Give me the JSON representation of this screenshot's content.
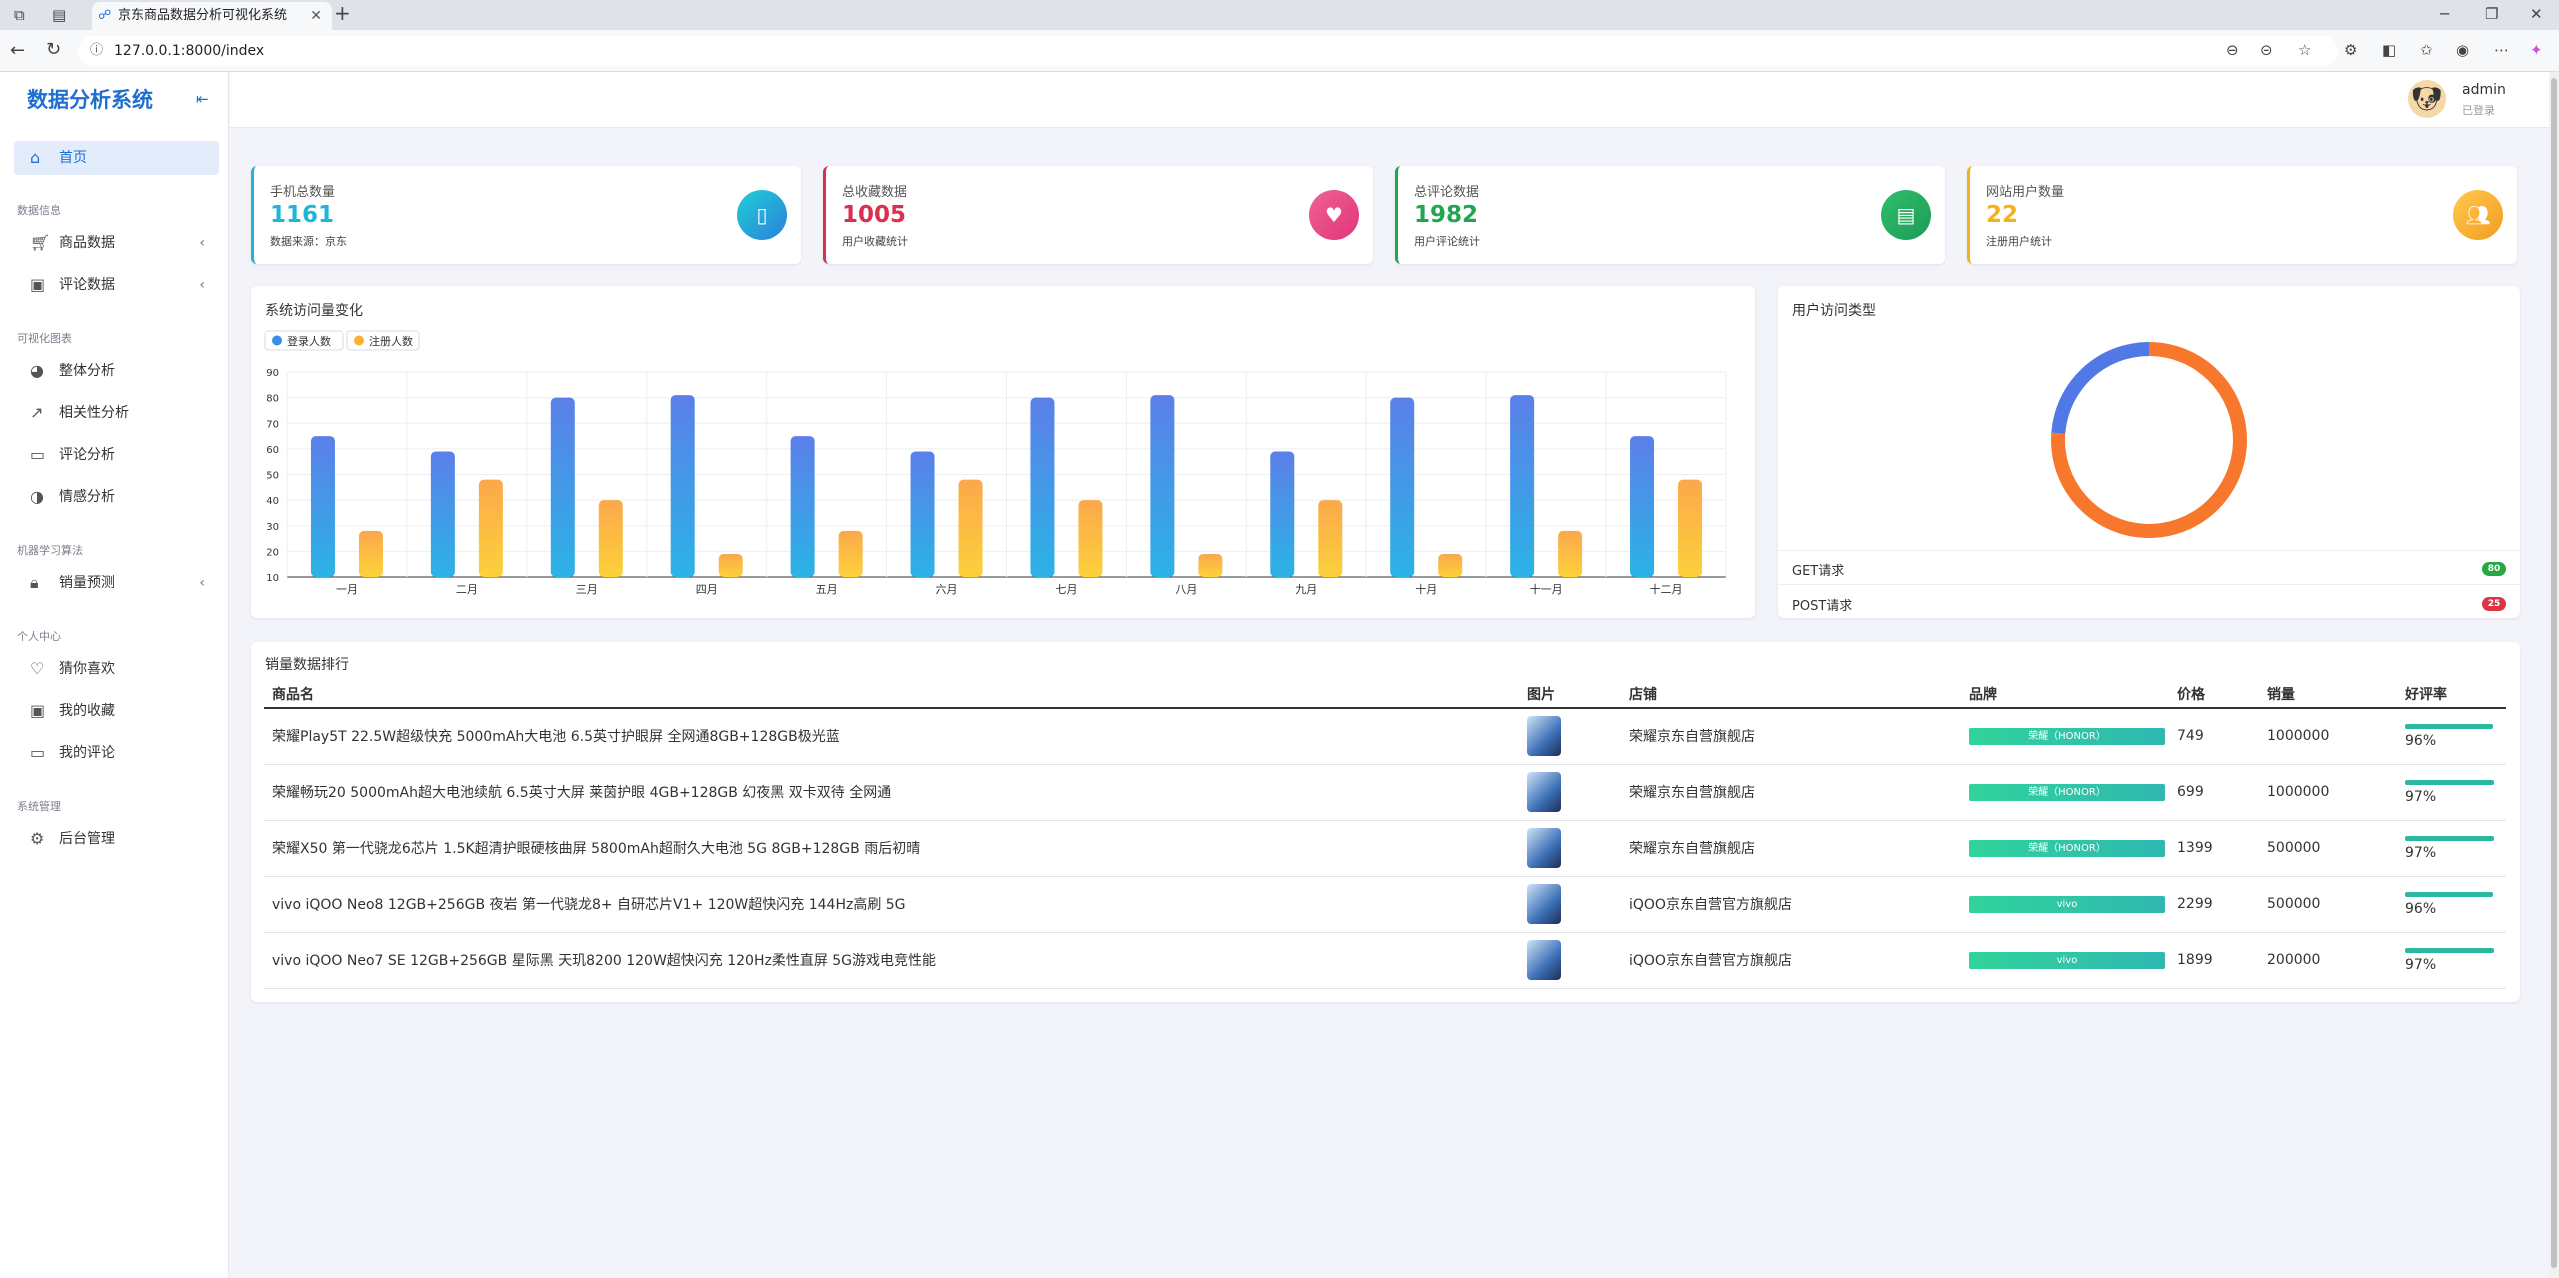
{
  "browser": {
    "tab_title": "京东商品数据分析可视化系统",
    "url": "127.0.0.1:8000/index"
  },
  "sidebar": {
    "brand": "数据分析系统",
    "home": "首页",
    "sections": [
      {
        "title": "数据信息",
        "items": [
          "商品数据",
          "评论数据"
        ]
      },
      {
        "title": "可视化图表",
        "items": [
          "整体分析",
          "相关性分析",
          "评论分析",
          "情感分析"
        ]
      },
      {
        "title": "机器学习算法",
        "items": [
          "销量预测"
        ]
      },
      {
        "title": "个人中心",
        "items": [
          "猜你喜欢",
          "我的收藏",
          "我的评论"
        ]
      },
      {
        "title": "系统管理",
        "items": [
          "后台管理"
        ]
      }
    ]
  },
  "user": {
    "name": "admin",
    "status": "已登录"
  },
  "stats": [
    {
      "label": "手机总数量",
      "value": "1161",
      "sub": "数据来源：京东",
      "color": "#1fb5d8"
    },
    {
      "label": "总收藏数据",
      "value": "1005",
      "sub": "用户收藏统计",
      "color": "#d9304f"
    },
    {
      "label": "总评论数据",
      "value": "1982",
      "sub": "用户评论统计",
      "color": "#1fa64f"
    },
    {
      "label": "网站用户数量",
      "value": "22",
      "sub": "注册用户统计",
      "color": "#f2b21c"
    }
  ],
  "bar_chart_title": "系统访问量变化",
  "pie_chart_title": "用户访问类型",
  "chart_data": [
    {
      "type": "bar",
      "title": "系统访问量变化",
      "categories": [
        "一月",
        "二月",
        "三月",
        "四月",
        "五月",
        "六月",
        "七月",
        "八月",
        "九月",
        "十月",
        "十一月",
        "十二月"
      ],
      "series": [
        {
          "name": "登录人数",
          "values": [
            65,
            59,
            80,
            81,
            65,
            59,
            80,
            81,
            59,
            80,
            81,
            65
          ],
          "color": "#3a8ee6"
        },
        {
          "name": "注册人数",
          "values": [
            28,
            48,
            40,
            19,
            28,
            48,
            40,
            19,
            40,
            19,
            28,
            48
          ],
          "color": "#fbb034"
        }
      ],
      "yticks": [
        10,
        20,
        30,
        40,
        50,
        60,
        70,
        80,
        90
      ],
      "ylim": [
        10,
        90
      ],
      "grid": true,
      "legend": "top-left"
    },
    {
      "type": "pie",
      "title": "用户访问类型",
      "labels": [
        "GET请求",
        "POST请求"
      ],
      "values": [
        80,
        25
      ],
      "colors": [
        "#f7782c",
        "#5078e6"
      ]
    }
  ],
  "requests": [
    {
      "label": "GET请求",
      "count": "80",
      "color": "#27a844"
    },
    {
      "label": "POST请求",
      "count": "25",
      "color": "#dc3545"
    }
  ],
  "table": {
    "title": "销量数据排行",
    "headers": [
      "商品名",
      "图片",
      "店铺",
      "品牌",
      "价格",
      "销量",
      "好评率"
    ],
    "rows": [
      {
        "name": "荣耀Play5T 22.5W超级快充 5000mAh大电池 6.5英寸护眼屏 全网通8GB+128GB极光蓝",
        "shop": "荣耀京东自营旗舰店",
        "brand": "荣耀（HONOR）",
        "price": "749",
        "sales": "1000000",
        "rate": "96%",
        "rate_value": 0.96
      },
      {
        "name": "荣耀畅玩20 5000mAh超大电池续航 6.5英寸大屏 莱茵护眼 4GB+128GB 幻夜黑 双卡双待 全网通",
        "shop": "荣耀京东自营旗舰店",
        "brand": "荣耀（HONOR）",
        "price": "699",
        "sales": "1000000",
        "rate": "97%",
        "rate_value": 0.97
      },
      {
        "name": "荣耀X50 第一代骁龙6芯片 1.5K超清护眼硬核曲屏 5800mAh超耐久大电池 5G 8GB+128GB 雨后初晴",
        "shop": "荣耀京东自营旗舰店",
        "brand": "荣耀（HONOR）",
        "price": "1399",
        "sales": "500000",
        "rate": "97%",
        "rate_value": 0.97
      },
      {
        "name": "vivo iQOO Neo8 12GB+256GB 夜岩 第一代骁龙8+ 自研芯片V1+ 120W超快闪充 144Hz高刷 5G",
        "shop": "iQOO京东自营官方旗舰店",
        "brand": "vivo",
        "price": "2299",
        "sales": "500000",
        "rate": "96%",
        "rate_value": 0.96
      },
      {
        "name": "vivo iQOO Neo7 SE 12GB+256GB 星际黑 天玑8200 120W超快闪充 120Hz柔性直屏 5G游戏电竞性能",
        "shop": "iQOO京东自营官方旗舰店",
        "brand": "vivo",
        "price": "1899",
        "sales": "200000",
        "rate": "97%",
        "rate_value": 0.97
      }
    ]
  }
}
